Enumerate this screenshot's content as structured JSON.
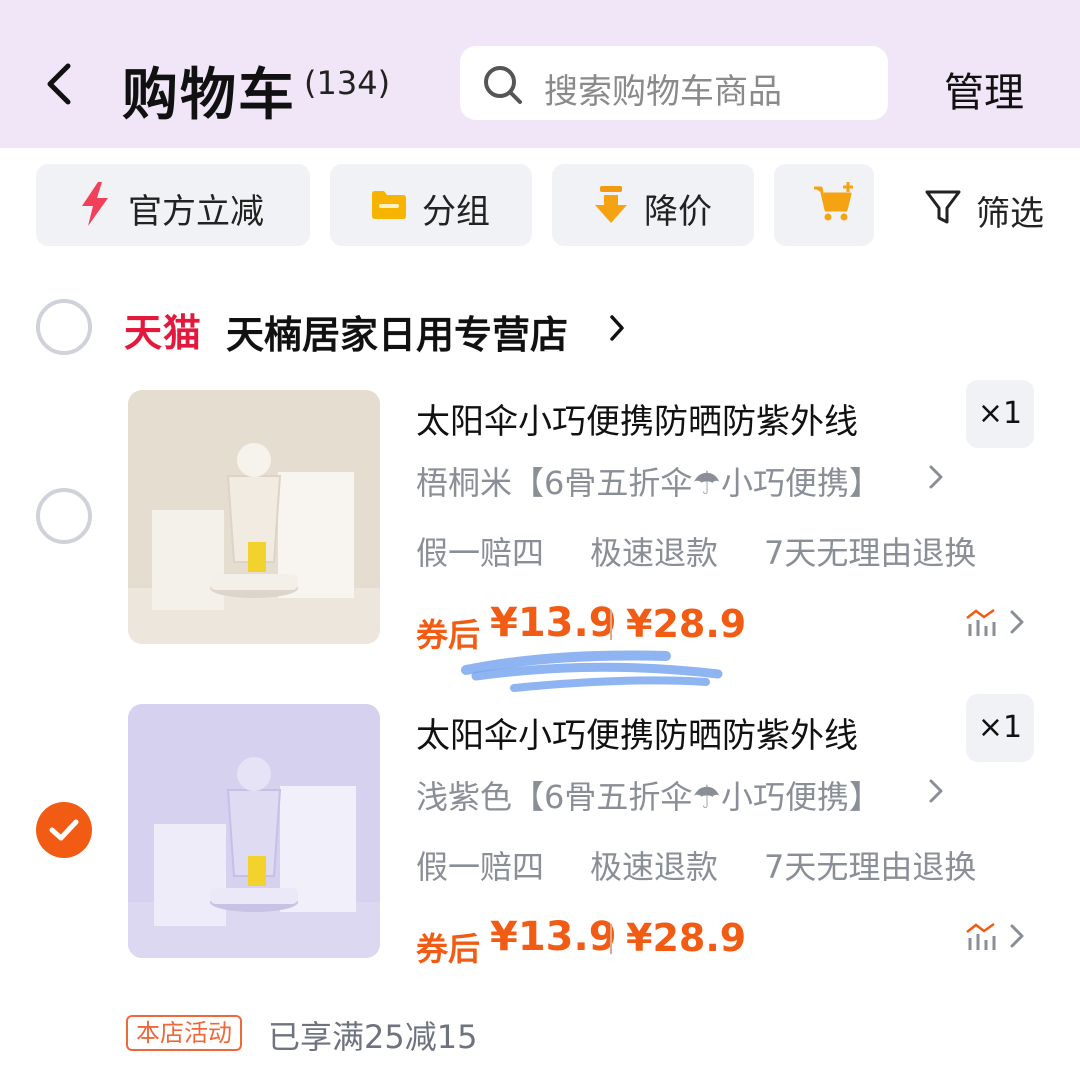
{
  "header": {
    "title": "购物车",
    "count": "(134)",
    "search_placeholder": "搜索购物车商品",
    "manage_label": "管理"
  },
  "filters": {
    "chips": [
      {
        "label": "官方立减",
        "icon": "lightning-icon"
      },
      {
        "label": "分组",
        "icon": "folder-icon"
      },
      {
        "label": "降价",
        "icon": "price-drop-arrow-icon"
      },
      {
        "label": "",
        "icon": "cart-add-icon"
      }
    ],
    "filter_label": "筛选"
  },
  "store": {
    "platform": "天猫",
    "name": "天楠居家日用专营店"
  },
  "items": [
    {
      "title": "太阳伞小巧便携防晒防紫外线",
      "spec": "梧桐米【6骨五折伞☂小巧便携】",
      "quantity": "×1",
      "services": [
        "假一赔四",
        "极速退款",
        "7天无理由退换"
      ],
      "coupon_label": "券后",
      "coupon_price": "¥13.9",
      "original_price": "¥28.9",
      "selected": false,
      "image_colors": {
        "bg": "#e6ddd1",
        "umbrella": "#f1ebe2"
      }
    },
    {
      "title": "太阳伞小巧便携防晒防紫外线",
      "spec": "浅紫色【6骨五折伞☂小巧便携】",
      "quantity": "×1",
      "services": [
        "假一赔四",
        "极速退款",
        "7天无理由退换"
      ],
      "coupon_label": "券后",
      "coupon_price": "¥13.9",
      "original_price": "¥28.9",
      "selected": true,
      "image_colors": {
        "bg": "#d6d1ee",
        "umbrella": "#dfdbf3"
      }
    }
  ],
  "promotion": {
    "badge": "本店活动",
    "text": "已享满25减15"
  },
  "colors": {
    "accent": "#f25b13",
    "header_bg": "#f0e6f7",
    "tmall_red": "#e4183c",
    "scribble_blue": "#7aa7f0"
  }
}
